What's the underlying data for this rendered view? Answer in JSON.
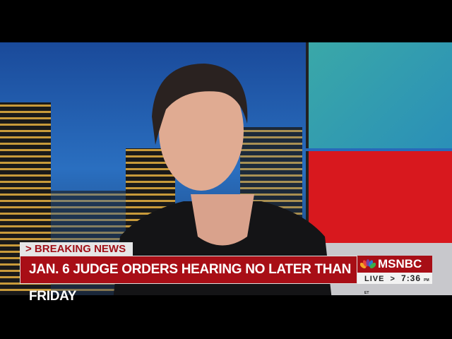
{
  "chyron": {
    "label": "> BREAKING NEWS",
    "headline": "JAN. 6 JUDGE ORDERS HEARING NO LATER THAN FRIDAY"
  },
  "network": {
    "name": "MSNBC",
    "live": "LIVE",
    "arrow": ">",
    "time": "7:36",
    "time_suffix": "PM ET"
  },
  "colors": {
    "chyron_red": "#a80e16",
    "accent_red": "#d8181e"
  }
}
